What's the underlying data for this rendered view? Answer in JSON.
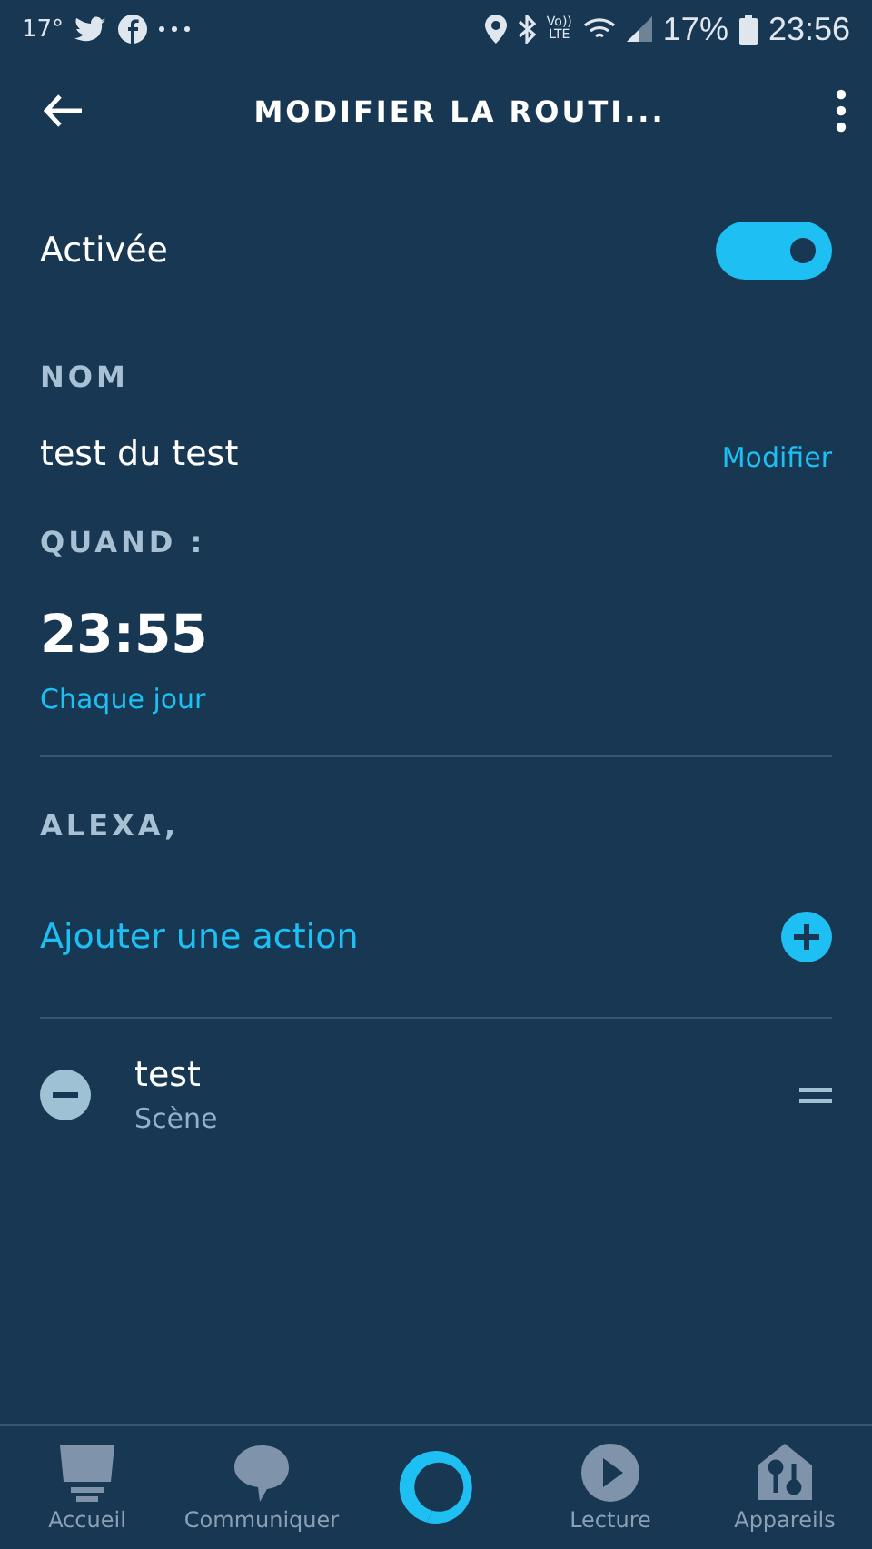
{
  "status_bar": {
    "temperature": "17°",
    "network": "Vo))\nLTE",
    "battery": "17%",
    "time": "23:56"
  },
  "app_bar": {
    "title": "MODIFIER LA ROUTI..."
  },
  "enabled": {
    "label": "Activée",
    "on": true
  },
  "name_section": {
    "heading": "NOM",
    "value": "test du test",
    "edit_link": "Modifier"
  },
  "when_section": {
    "heading": "QUAND :",
    "time": "23:55",
    "repeat": "Chaque jour"
  },
  "alexa_section": {
    "heading": "ALEXA,",
    "add_action": "Ajouter une action"
  },
  "actions": [
    {
      "title": "test",
      "subtitle": "Scène"
    }
  ],
  "bottom_nav": [
    {
      "label": "Accueil",
      "kind": "home",
      "selected": false
    },
    {
      "label": "Communiquer",
      "kind": "chat",
      "selected": false
    },
    {
      "kind": "alexa"
    },
    {
      "label": "Lecture",
      "kind": "play",
      "selected": false
    },
    {
      "label": "Appareils",
      "kind": "devices",
      "selected": false
    }
  ]
}
